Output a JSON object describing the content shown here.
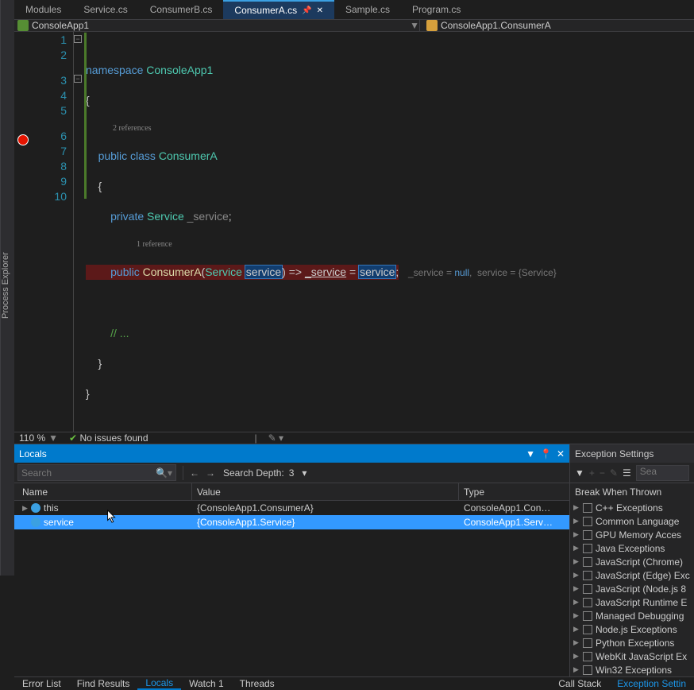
{
  "leftRail": "Process Explorer",
  "tabs": [
    {
      "label": "Modules"
    },
    {
      "label": "Service.cs"
    },
    {
      "label": "ConsumerB.cs"
    },
    {
      "label": "ConsumerA.cs",
      "active": true
    },
    {
      "label": "Sample.cs"
    },
    {
      "label": "Program.cs"
    }
  ],
  "nav": {
    "left": "ConsoleApp1",
    "right": "ConsoleApp1.ConsumerA"
  },
  "code": {
    "l1_kw": "namespace",
    "l1_id": "ConsoleApp1",
    "l2": "{",
    "ref2": "2 references",
    "l3_kw": "public class",
    "l3_id": "ConsumerA",
    "l4": "    {",
    "l5_kw": "private",
    "l5_type": "Service",
    "l5_field": "_service",
    "l5_end": ";",
    "ref1": "1 reference",
    "l6_kw": "public",
    "l6_ctor": "ConsumerA",
    "l6_p1": "(",
    "l6_ptype": "Service",
    "l6_pname": "service",
    "l6_p2": ")",
    "l6_arrow": " => ",
    "l6_lhs": "_service",
    "l6_eq": " = ",
    "l6_rhs": "service",
    "l6_sc": ";",
    "l6_hint_a": "_service = ",
    "l6_hint_an": "null",
    "l6_hint_b": ",",
    "l6_hint_c": "  service = {Service}",
    "l8": "        // ...",
    "l9": "    }",
    "l10": "}",
    "lines": [
      "1",
      "2",
      "3",
      "4",
      "5",
      "6",
      "7",
      "8",
      "9",
      "10"
    ]
  },
  "status": {
    "zoom": "110 %",
    "issues": "No issues found"
  },
  "locals": {
    "title": "Locals",
    "searchPh": "Search",
    "depthLabel": "Search Depth:",
    "depth": "3",
    "cols": {
      "name": "Name",
      "value": "Value",
      "type": "Type"
    },
    "rows": [
      {
        "name": "this",
        "value": "{ConsoleApp1.ConsumerA}",
        "type": "ConsoleApp1.Con…",
        "sel": false
      },
      {
        "name": "service",
        "value": "{ConsoleApp1.Service}",
        "type": "ConsoleApp1.Serv…",
        "sel": true
      }
    ]
  },
  "exceptions": {
    "title": "Exception Settings",
    "searchPh": "Sea",
    "subtitle": "Break When Thrown",
    "items": [
      "C++ Exceptions",
      "Common Language",
      "GPU Memory Acces",
      "Java Exceptions",
      "JavaScript (Chrome)",
      "JavaScript (Edge) Exc",
      "JavaScript (Node.js 8",
      "JavaScript Runtime E",
      "Managed Debugging",
      "Node.js Exceptions",
      "Python Exceptions",
      "WebKit JavaScript Ex",
      "Win32 Exceptions"
    ]
  },
  "bottomTabs": {
    "left": [
      "Error List",
      "Find Results",
      "Locals",
      "Watch 1",
      "Threads"
    ],
    "active": "Locals",
    "right": [
      "Call Stack",
      "Exception Settin"
    ]
  }
}
